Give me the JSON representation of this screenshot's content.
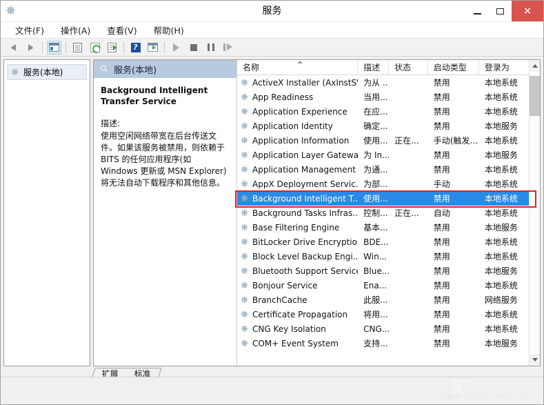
{
  "window": {
    "title": "服务",
    "icon": "services-gear-icon",
    "minimize_label": "最小化",
    "maximize_label": "最大化",
    "close_label": "关闭",
    "close_glyph": "✕",
    "accent_close": "#d9534f",
    "selection_color": "#2a8ae8",
    "highlight_box_color": "#e02020"
  },
  "menu": {
    "items": [
      {
        "label": "文件(F)",
        "name": "menu-file"
      },
      {
        "label": "操作(A)",
        "name": "menu-action"
      },
      {
        "label": "查看(V)",
        "name": "menu-view"
      },
      {
        "label": "帮助(H)",
        "name": "menu-help"
      }
    ]
  },
  "toolbar": {
    "buttons": [
      {
        "name": "back-arrow-icon",
        "tip": "后退"
      },
      {
        "name": "forward-arrow-icon",
        "tip": "前进"
      },
      {
        "name": "show-hide-tree-icon",
        "tip": "显示/隐藏控制台树"
      },
      {
        "name": "properties-icon",
        "tip": "属性"
      },
      {
        "name": "refresh-icon",
        "tip": "刷新"
      },
      {
        "name": "export-list-icon",
        "tip": "导出列表"
      },
      {
        "name": "help-icon",
        "tip": "帮助"
      },
      {
        "name": "console-view-icon",
        "tip": "显示操作窗格"
      },
      {
        "name": "start-service-icon",
        "tip": "启动服务"
      },
      {
        "name": "stop-service-icon",
        "tip": "停止服务"
      },
      {
        "name": "pause-service-icon",
        "tip": "暂停服务"
      },
      {
        "name": "restart-service-icon",
        "tip": "重启服务"
      }
    ]
  },
  "tree": {
    "root": {
      "label": "服务(本地)",
      "icon": "services-gear-icon"
    }
  },
  "detail": {
    "header": "服务(本地)",
    "header_icon": "magnifier-icon",
    "service_title": "Background Intelligent Transfer Service",
    "description_label": "描述:",
    "description_text": "使用空闲网络带宽在后台传送文件。如果该服务被禁用，则依赖于 BITS 的任何应用程序(如 Windows 更新或 MSN Explorer)将无法自动下载程序和其他信息。"
  },
  "list": {
    "columns": [
      {
        "key": "name",
        "label": "名称",
        "sorted": true
      },
      {
        "key": "desc",
        "label": "描述",
        "sorted": false
      },
      {
        "key": "status",
        "label": "状态",
        "sorted": false
      },
      {
        "key": "start",
        "label": "启动类型",
        "sorted": false
      },
      {
        "key": "logon",
        "label": "登录为",
        "sorted": false
      }
    ],
    "rows": [
      {
        "name": "ActiveX Installer (AxInstSV)",
        "desc": "为从 ...",
        "status": "",
        "start": "禁用",
        "logon": "本地系统",
        "selected": false
      },
      {
        "name": "App Readiness",
        "desc": "当用...",
        "status": "",
        "start": "禁用",
        "logon": "本地系统",
        "selected": false
      },
      {
        "name": "Application Experience",
        "desc": "在应...",
        "status": "",
        "start": "禁用",
        "logon": "本地系统",
        "selected": false
      },
      {
        "name": "Application Identity",
        "desc": "确定...",
        "status": "",
        "start": "禁用",
        "logon": "本地服务",
        "selected": false
      },
      {
        "name": "Application Information",
        "desc": "使用...",
        "status": "正在...",
        "start": "手动(触发...",
        "logon": "本地系统",
        "selected": false
      },
      {
        "name": "Application Layer Gatewa...",
        "desc": "为 In...",
        "status": "",
        "start": "禁用",
        "logon": "本地服务",
        "selected": false
      },
      {
        "name": "Application Management",
        "desc": "为通...",
        "status": "",
        "start": "禁用",
        "logon": "本地系统",
        "selected": false
      },
      {
        "name": "AppX Deployment Servic...",
        "desc": "为部...",
        "status": "",
        "start": "手动",
        "logon": "本地系统",
        "selected": false
      },
      {
        "name": "Background Intelligent T...",
        "desc": "使用...",
        "status": "",
        "start": "禁用",
        "logon": "本地系统",
        "selected": true
      },
      {
        "name": "Background Tasks Infras...",
        "desc": "控制...",
        "status": "正在...",
        "start": "自动",
        "logon": "本地系统",
        "selected": false
      },
      {
        "name": "Base Filtering Engine",
        "desc": "基本...",
        "status": "",
        "start": "禁用",
        "logon": "本地服务",
        "selected": false
      },
      {
        "name": "BitLocker Drive Encryptio...",
        "desc": "BDE...",
        "status": "",
        "start": "禁用",
        "logon": "本地系统",
        "selected": false
      },
      {
        "name": "Block Level Backup Engi...",
        "desc": "Win...",
        "status": "",
        "start": "禁用",
        "logon": "本地系统",
        "selected": false
      },
      {
        "name": "Bluetooth Support Service",
        "desc": "Blue...",
        "status": "",
        "start": "禁用",
        "logon": "本地服务",
        "selected": false
      },
      {
        "name": "Bonjour Service",
        "desc": "Ena...",
        "status": "",
        "start": "禁用",
        "logon": "本地系统",
        "selected": false
      },
      {
        "name": "BranchCache",
        "desc": "此服...",
        "status": "",
        "start": "禁用",
        "logon": "网络服务",
        "selected": false
      },
      {
        "name": "Certificate Propagation",
        "desc": "将用...",
        "status": "",
        "start": "禁用",
        "logon": "本地系统",
        "selected": false
      },
      {
        "name": "CNG Key Isolation",
        "desc": "CNG...",
        "status": "",
        "start": "禁用",
        "logon": "本地系统",
        "selected": false
      },
      {
        "name": "COM+ Event System",
        "desc": "支持...",
        "status": "",
        "start": "禁用",
        "logon": "本地服务",
        "selected": false
      }
    ],
    "scrollbar": {
      "up_label": "向上滚动",
      "down_label": "向下滚动"
    }
  },
  "tabs": [
    {
      "label": "扩展",
      "name": "tab-extended",
      "active": false
    },
    {
      "label": "标准",
      "name": "tab-standard",
      "active": true
    }
  ],
  "watermark": {
    "text": "系统之家",
    "subtext": "WWW.XTZJXITONG.COM"
  }
}
